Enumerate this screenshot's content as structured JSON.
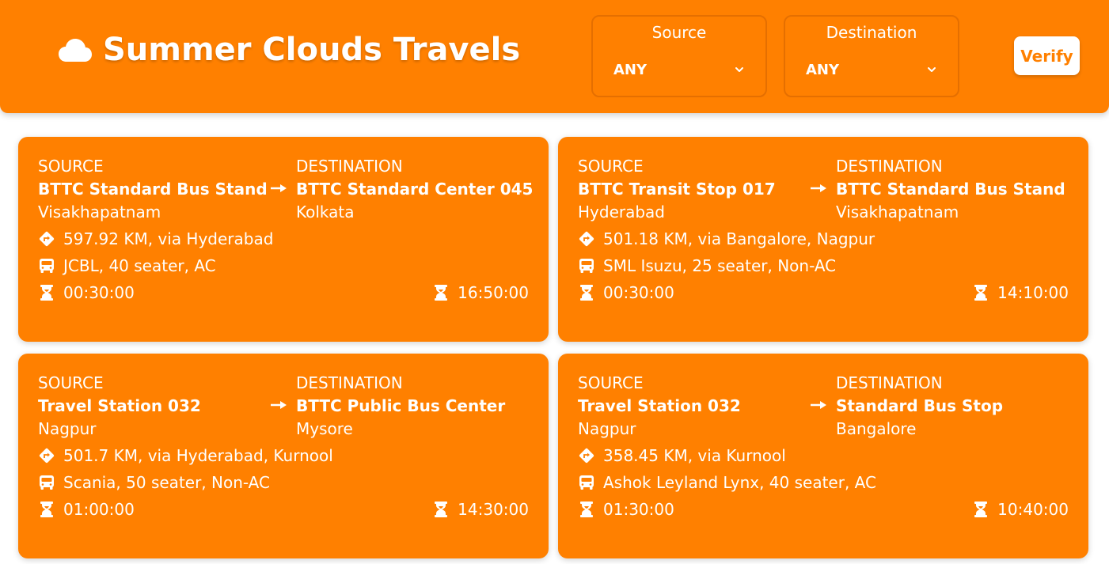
{
  "header": {
    "brand_icon": "cloud-icon",
    "title": "Summer Clouds Travels",
    "source_filter": {
      "label": "Source",
      "value": "ANY"
    },
    "destination_filter": {
      "label": "Destination",
      "value": "ANY"
    },
    "verify_label": "Verify"
  },
  "labels": {
    "source": "SOURCE",
    "destination": "DESTINATION"
  },
  "colors": {
    "accent": "#ff8000",
    "text": "#ffffff",
    "button_bg": "#ffffff"
  },
  "trips": [
    {
      "source_stop": "BTTC Standard Bus Stand",
      "source_city": "Visakhapatnam",
      "dest_stop": "BTTC Standard Center 045",
      "dest_city": "Kolkata",
      "distance": "597.92 KM, via Hyderabad",
      "bus": "JCBL, 40 seater, AC",
      "departure": "00:30:00",
      "arrival": "16:50:00"
    },
    {
      "source_stop": "BTTC Transit Stop 017",
      "source_city": "Hyderabad",
      "dest_stop": "BTTC Standard Bus Stand",
      "dest_city": "Visakhapatnam",
      "distance": "501.18 KM, via Bangalore, Nagpur",
      "bus": "SML Isuzu, 25 seater, Non-AC",
      "departure": "00:30:00",
      "arrival": "14:10:00"
    },
    {
      "source_stop": "Travel Station 032",
      "source_city": "Nagpur",
      "dest_stop": "BTTC Public Bus Center",
      "dest_city": "Mysore",
      "distance": "501.7 KM, via Hyderabad, Kurnool",
      "bus": "Scania, 50 seater, Non-AC",
      "departure": "01:00:00",
      "arrival": "14:30:00"
    },
    {
      "source_stop": "Travel Station 032",
      "source_city": "Nagpur",
      "dest_stop": "Standard Bus Stop",
      "dest_city": "Bangalore",
      "distance": "358.45 KM, via Kurnool",
      "bus": "Ashok Leyland Lynx, 40 seater, AC",
      "departure": "01:30:00",
      "arrival": "10:40:00"
    }
  ]
}
